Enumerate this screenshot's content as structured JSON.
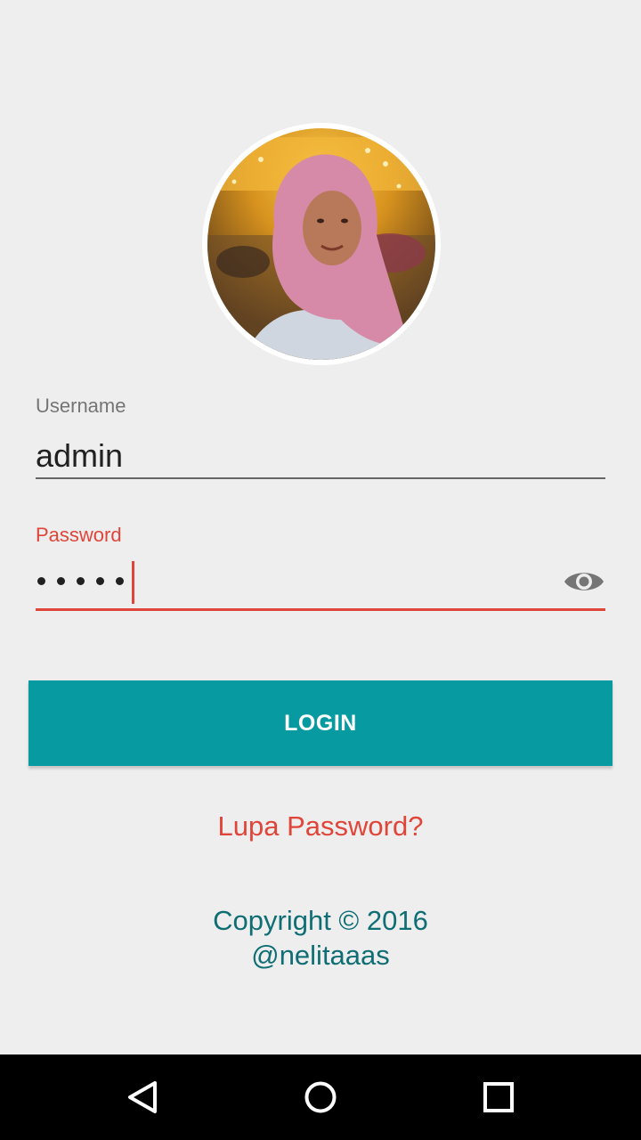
{
  "avatar": {
    "alt": "Profile photo"
  },
  "username": {
    "label": "Username",
    "value": "admin"
  },
  "password": {
    "label": "Password",
    "masked_length": 5
  },
  "login_button": {
    "label": "LOGIN"
  },
  "forgot_link": {
    "label": "Lupa Password?"
  },
  "copyright": {
    "line1": "Copyright © 2016",
    "line2": "@nelitaaas"
  },
  "colors": {
    "accent": "#089aa1",
    "error": "#e0453a",
    "footer_text": "#0f6e74",
    "background": "#eeeeee"
  },
  "icons": {
    "password_toggle": "eye-icon",
    "nav_back": "back-triangle-icon",
    "nav_home": "home-circle-icon",
    "nav_recent": "recent-apps-square-icon"
  }
}
